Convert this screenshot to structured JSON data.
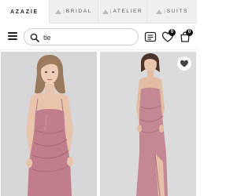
{
  "topnav": {
    "brand": "AZAZIE",
    "tabs": [
      {
        "label": "BRIDAL"
      },
      {
        "label": "ATELIER"
      },
      {
        "label": "SUITS"
      }
    ],
    "separator": "|"
  },
  "header": {
    "search": {
      "value": "tie"
    },
    "cart_badge": "0",
    "wishlist_badge": "0"
  },
  "products": [
    {
      "dress_color": "#c07e8c"
    },
    {
      "dress_color": "#c48794"
    }
  ]
}
